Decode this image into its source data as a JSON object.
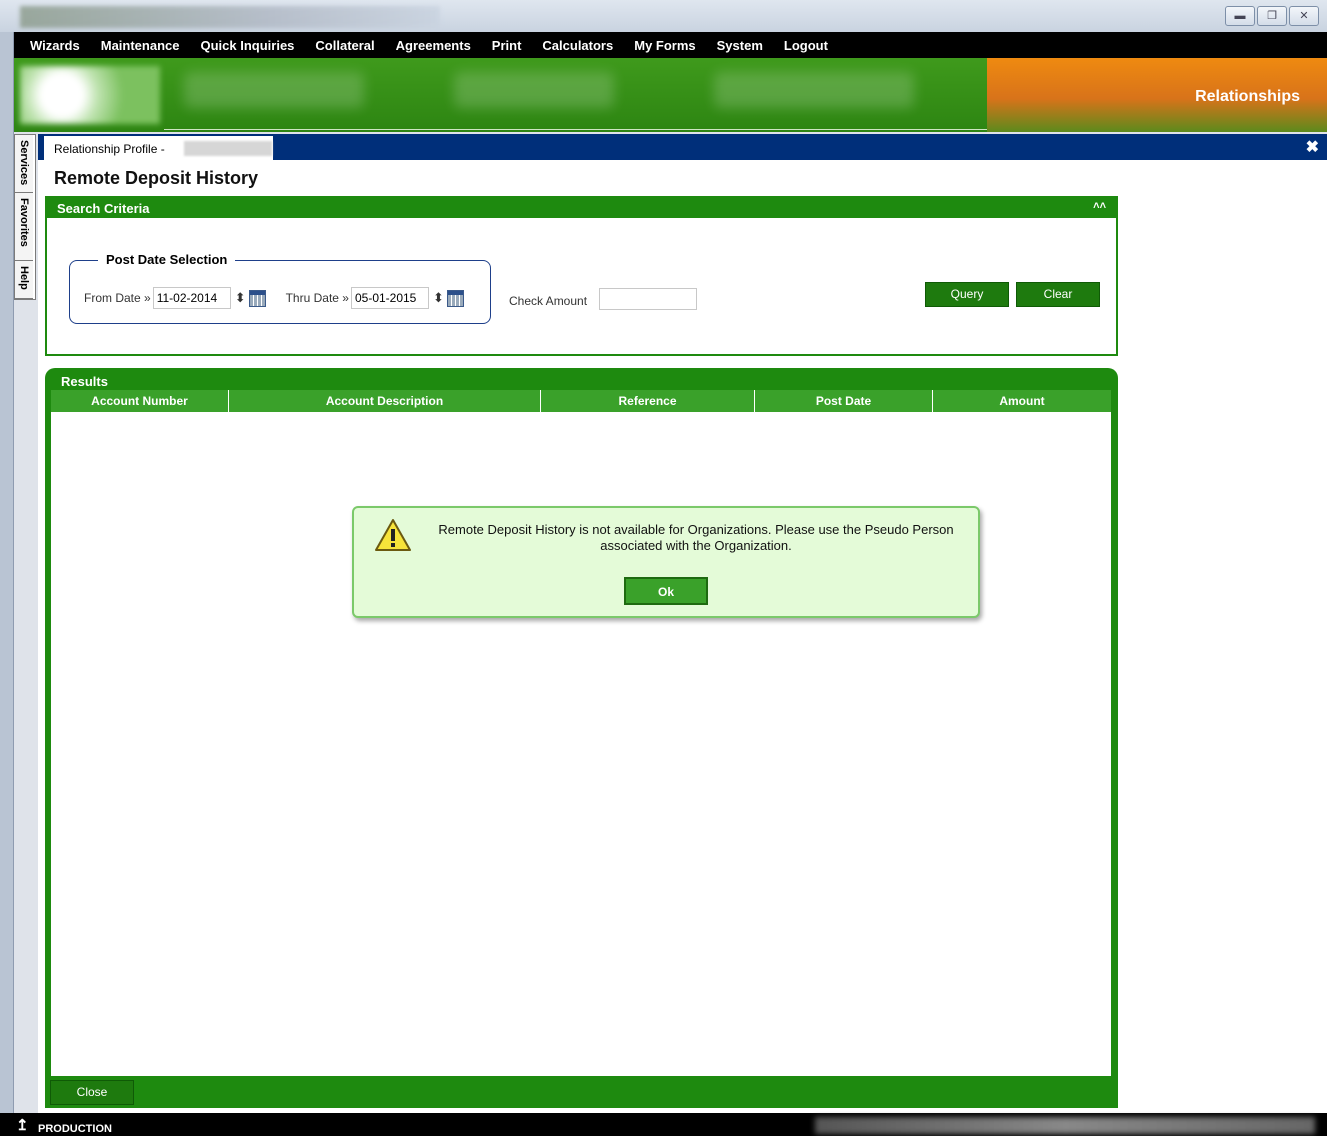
{
  "menu": [
    "Wizards",
    "Maintenance",
    "Quick Inquiries",
    "Collateral",
    "Agreements",
    "Print",
    "Calculators",
    "My Forms",
    "System",
    "Logout"
  ],
  "banner": {
    "title": "Relationships"
  },
  "side_tabs": [
    "Services",
    "Favorites",
    "Help"
  ],
  "tab": {
    "label": "Relationship Profile -"
  },
  "page": {
    "title": "Remote Deposit History"
  },
  "search": {
    "header": "Search Criteria",
    "collapse_icon": "double-chevron-up",
    "fieldset_legend": "Post Date Selection",
    "from_label": "From Date »",
    "from_value": "11-02-2014",
    "thru_label": "Thru Date »",
    "thru_value": "05-01-2015",
    "check_amount_label": "Check Amount",
    "check_amount_value": "",
    "query_label": "Query",
    "clear_label": "Clear"
  },
  "results": {
    "header": "Results",
    "columns": [
      "Account Number",
      "Account Description",
      "Reference",
      "Post Date",
      "Amount"
    ],
    "close_label": "Close"
  },
  "dialog": {
    "icon": "warning-icon",
    "message": "Remote Deposit History is not available for Organizations. Please use the Pseudo Person associated with the Organization.",
    "ok_label": "Ok"
  },
  "status": {
    "environment": "PRODUCTION"
  },
  "colors": {
    "green": "#1e8a0f",
    "navy": "#002f7a",
    "orange": "#ef8a10"
  }
}
